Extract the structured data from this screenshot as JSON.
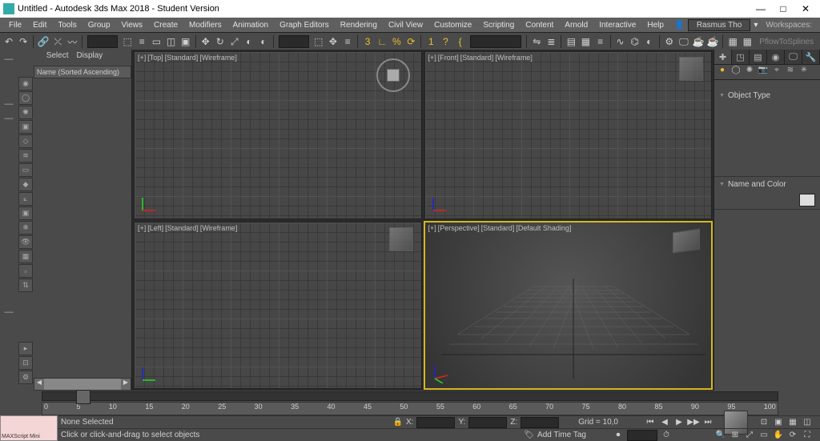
{
  "titlebar": {
    "icon_name": "3dsmax-logo",
    "title": "Untitled - Autodesk 3ds Max 2018 - Student Version",
    "min": "—",
    "max": "□",
    "close": "✕"
  },
  "menu": [
    "File",
    "Edit",
    "Tools",
    "Group",
    "Views",
    "Create",
    "Modifiers",
    "Animation",
    "Graph Editors",
    "Rendering",
    "Civil View",
    "Customize",
    "Scripting",
    "Content",
    "Arnold",
    "Interactive",
    "Help"
  ],
  "user": "Rasmus Tho",
  "workspaces_label": "Workspaces:",
  "ribbon_tab": "PflowToSplines",
  "left_tabs": {
    "select": "Select",
    "display": "Display"
  },
  "scene_explorer": {
    "header": "Name (Sorted Ascending)"
  },
  "viewports": {
    "top": {
      "plus": "[+]",
      "name": "[Top]",
      "std": "[Standard]",
      "shade": "[Wireframe]"
    },
    "front": {
      "plus": "[+]",
      "name": "[Front]",
      "std": "[Standard]",
      "shade": "[Wireframe]"
    },
    "left": {
      "plus": "[+]",
      "name": "[Left]",
      "std": "[Standard]",
      "shade": "[Wireframe]"
    },
    "persp": {
      "plus": "[+]",
      "name": "[Perspective]",
      "std": "[Standard]",
      "shade": "[Default Shading]"
    }
  },
  "command_panel": {
    "rollout1": "Object Type",
    "rollout2": "Name and Color"
  },
  "timeline": {
    "ticks": [
      "0",
      "5",
      "10",
      "15",
      "20",
      "25",
      "30",
      "35",
      "40",
      "45",
      "50",
      "55",
      "60",
      "65",
      "70",
      "75",
      "80",
      "85",
      "90",
      "95",
      "100"
    ]
  },
  "status": {
    "maxscript": "MAXScript Mini",
    "selection": "None Selected",
    "prompt": "Click or click-and-drag to select objects",
    "x": "X:",
    "y": "Y:",
    "z": "Z:",
    "grid": "Grid = 10,0",
    "add_time_tag": "Add Time Tag"
  },
  "icons": {
    "undo": "↶",
    "redo": "↷",
    "link": "🔗",
    "unlink": "⤫",
    "bind": "〰",
    "sel_filter": "▾",
    "sel_obj": "⬚",
    "sel_name": "≡",
    "sel_rect": "▭",
    "sel_win": "◫",
    "sel_cross": "▣",
    "move": "✥",
    "rot": "↻",
    "scale": "⤢",
    "ref": "◐",
    "snap": "🧲",
    "ang_snap": "∟",
    "pct_snap": "%",
    "spinner": "⟳",
    "n1": "1",
    "n2": "?",
    "curly": "{",
    "mirror": "⇋",
    "align": "≣",
    "layers": "▤",
    "layer_exp": "▦",
    "curve_ed": "∿",
    "schem": "⌬",
    "mat_ed": "◐",
    "render_set": "⚙",
    "render_frame": "🖵",
    "render": "☕",
    "create": "✚",
    "modify": "◳",
    "hier": "▤",
    "motion": "◉",
    "display": "🖵",
    "util": "🔧",
    "geom": "●",
    "shape": "◯",
    "light": "✺",
    "cam": "📷",
    "helper": "⌖",
    "space": "≋",
    "sys": "✳",
    "play_start": "⏮",
    "play_prev": "◀",
    "play": "▶",
    "play_next": "▶▶",
    "play_end": "⏭",
    "key": "🔑",
    "key_mode": "⏺"
  }
}
